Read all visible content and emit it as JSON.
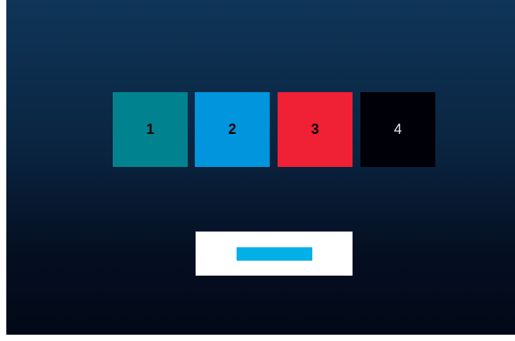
{
  "tiles": [
    {
      "label": "1",
      "color": "#00838f"
    },
    {
      "label": "2",
      "color": "#0095dd"
    },
    {
      "label": "3",
      "color": "#f02035"
    },
    {
      "label": "4",
      "color": "#000008"
    }
  ],
  "panel": {
    "background": "#ffffff",
    "bar_color": "#00b0e6"
  }
}
